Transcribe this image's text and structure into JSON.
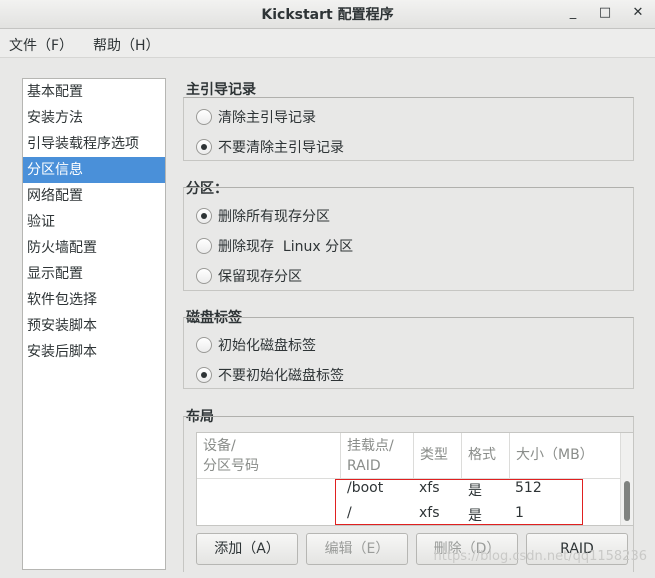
{
  "window": {
    "title": "Kickstart 配置程序",
    "minimize": "_",
    "maximize": "□",
    "close": "✕"
  },
  "menubar": {
    "file": "文件（F）",
    "help": "帮助（H）"
  },
  "sidebar": {
    "items": [
      {
        "label": "基本配置"
      },
      {
        "label": "安装方法"
      },
      {
        "label": "引导装载程序选项"
      },
      {
        "label": "分区信息",
        "selected": true
      },
      {
        "label": "网络配置"
      },
      {
        "label": "验证"
      },
      {
        "label": "防火墙配置"
      },
      {
        "label": "显示配置"
      },
      {
        "label": "软件包选择"
      },
      {
        "label": "预安装脚本"
      },
      {
        "label": "安装后脚本"
      }
    ]
  },
  "mbr": {
    "title": "主引导记录",
    "options": [
      {
        "label": "清除主引导记录",
        "checked": false
      },
      {
        "label": "不要清除主引导记录",
        "checked": true
      }
    ]
  },
  "partition": {
    "title": "分区：",
    "options": [
      {
        "label": "删除所有现存分区",
        "checked": true
      },
      {
        "label": "删除现存  Linux 分区",
        "checked": false
      },
      {
        "label": "保留现存分区",
        "checked": false
      }
    ]
  },
  "disklabel": {
    "title": "磁盘标签",
    "options": [
      {
        "label": "初始化磁盘标签",
        "checked": false
      },
      {
        "label": "不要初始化磁盘标签",
        "checked": true
      }
    ]
  },
  "layout": {
    "title": "布局",
    "columns": {
      "device": "设备/\n分区号码",
      "mount": "挂载点/\nRAID",
      "type": "类型",
      "format": "格式",
      "size": "大小（MB）"
    },
    "rows": [
      {
        "device": "",
        "mount": "/boot",
        "type": "xfs",
        "format": "是",
        "size": "512"
      },
      {
        "device": "",
        "mount": "/",
        "type": "xfs",
        "format": "是",
        "size": "1"
      }
    ],
    "buttons": {
      "add": "添加（A）",
      "edit": "编辑（E）",
      "delete": "删除（D）",
      "raid": "RAID"
    }
  },
  "watermark": "https://blog.csdn.net/qq1158236"
}
